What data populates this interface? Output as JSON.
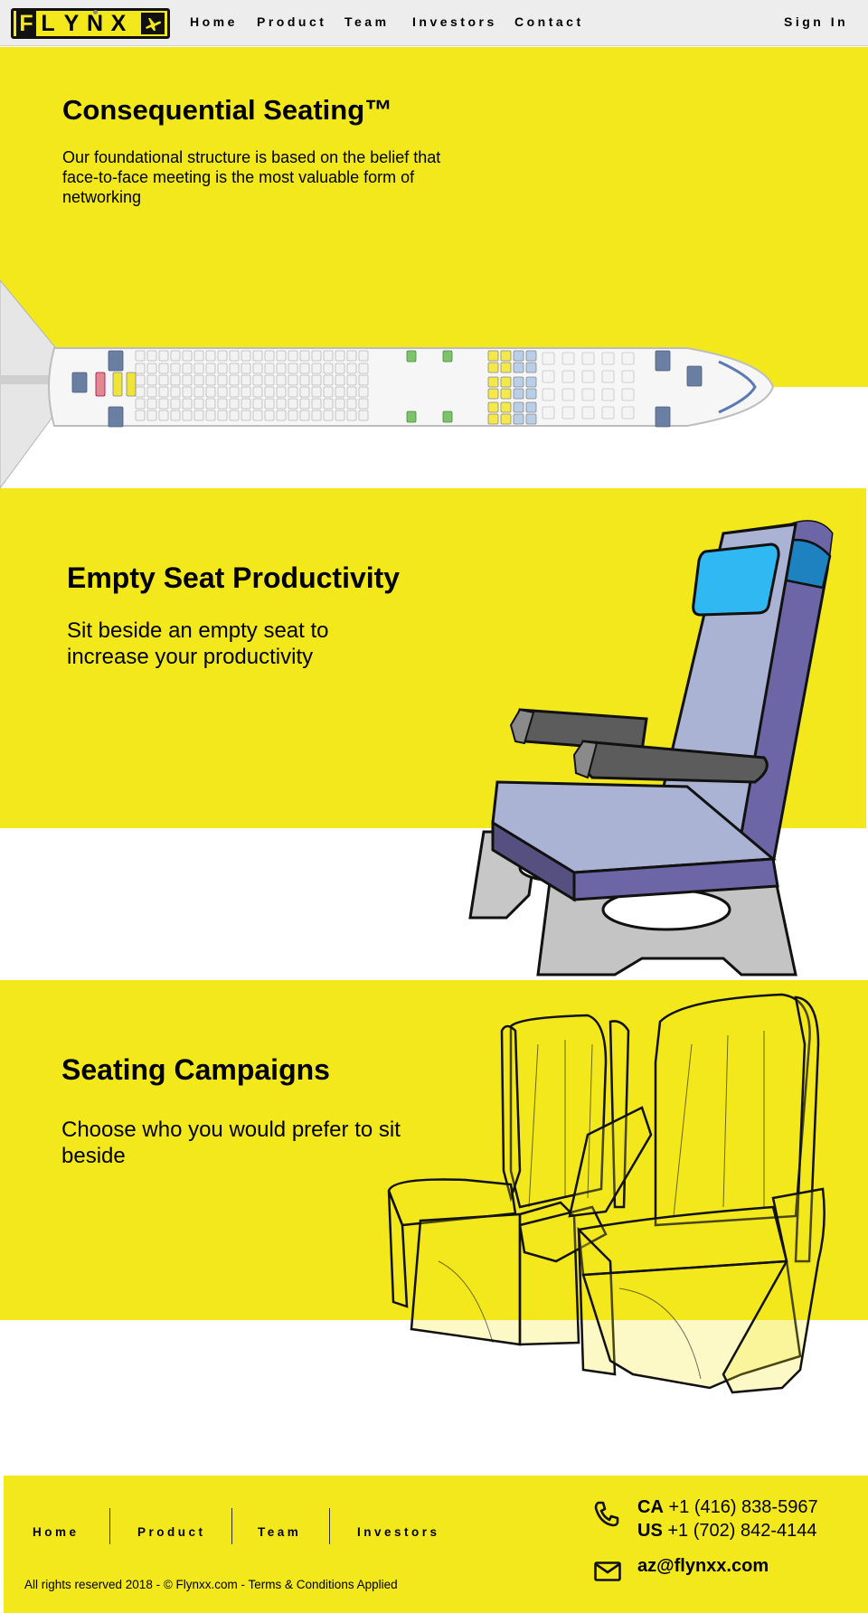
{
  "logo": {
    "letters": [
      "F",
      "L",
      "Y",
      "N",
      "X"
    ],
    "icon": "airplane-icon"
  },
  "nav": {
    "items": [
      "Home",
      "Product",
      "Team",
      "Investors",
      "Contact"
    ],
    "sign_in": "Sign In"
  },
  "sections": {
    "seating": {
      "title": "Consequential Seating™",
      "body": "Our foundational structure is based on the belief that face-to-face meeting is the most valuable form of networking"
    },
    "empty_seat": {
      "title": "Empty Seat Productivity",
      "body": "Sit beside an empty seat to increase your productivity"
    },
    "campaigns": {
      "title": "Seating Campaigns",
      "body": "Choose who you would prefer to sit beside"
    }
  },
  "footer": {
    "links": [
      "Home",
      "Product",
      "Team",
      "Investors"
    ],
    "copyright": "All rights reserved 2018 - © Flynxx.com - Terms & Conditions Applied",
    "phone_ca_label": "CA",
    "phone_ca": "+1 (416) 838-5967",
    "phone_us_label": "US",
    "phone_us": "+1 (702) 842-4144",
    "email": "az@flynxx.com",
    "phone_icon": "phone-icon",
    "mail_icon": "envelope-icon"
  },
  "colors": {
    "brand_yellow": "#f2e81b",
    "nav_bg": "#ededed",
    "seat_purple": "#6c66a6",
    "seat_light": "#aab3d3",
    "screen_blue": "#2fb8f2"
  }
}
